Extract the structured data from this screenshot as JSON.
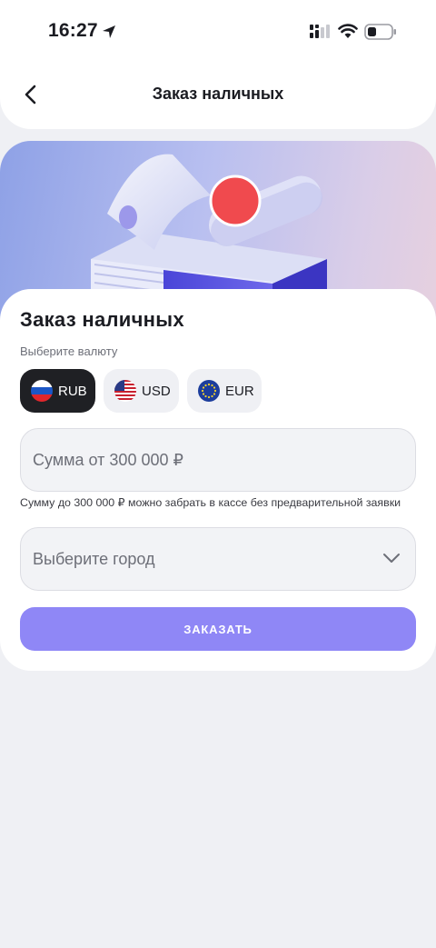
{
  "status_bar": {
    "time": "16:27",
    "location_icon": "location-arrow-icon",
    "signal_icon": "cellular-signal-icon",
    "wifi_icon": "wifi-icon",
    "battery_icon": "battery-icon"
  },
  "header": {
    "back_icon": "chevron-left-icon",
    "title": "Заказ наличных"
  },
  "hero": {
    "illustration": "cash-banknotes-illustration"
  },
  "form": {
    "title": "Заказ наличных",
    "currency_label": "Выберите валюту",
    "currencies": [
      {
        "code": "RUB",
        "flag": "russia-flag-icon",
        "selected": true
      },
      {
        "code": "USD",
        "flag": "usa-flag-icon",
        "selected": false
      },
      {
        "code": "EUR",
        "flag": "eu-flag-icon",
        "selected": false
      }
    ],
    "amount_placeholder": "Сумма от 300 000 ₽",
    "amount_hint": "Сумму до 300 000 ₽ можно забрать в кассе без предварительной заявки",
    "city_placeholder": "Выберите город",
    "submit_label": "ЗАКАЗАТЬ"
  },
  "colors": {
    "accent": "#8f87f6",
    "chip_active": "#1f2024",
    "background": "#eff0f4"
  }
}
